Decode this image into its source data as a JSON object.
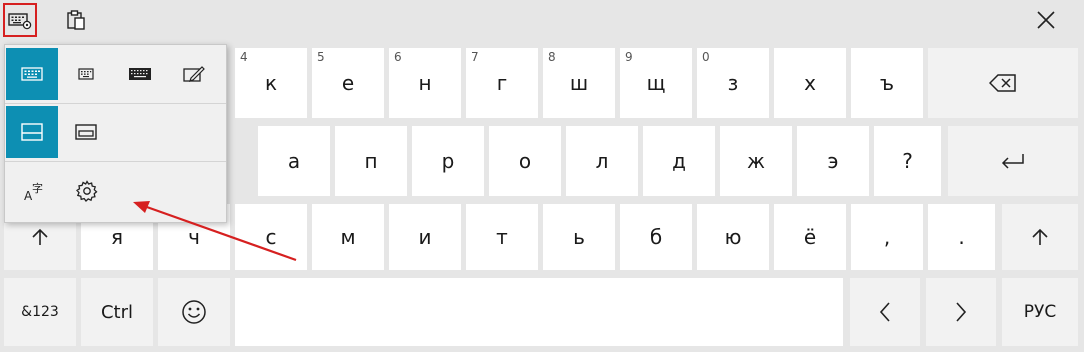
{
  "topbar": {
    "layout_button_icon": "keyboard-settings-icon",
    "clipboard_icon": "clipboard-icon",
    "close_icon": "close-icon"
  },
  "layout_menu": {
    "row1": [
      "keyboard-default-icon",
      "keyboard-small-icon",
      "keyboard-full-icon",
      "handwriting-icon"
    ],
    "row2": [
      "docked-keyboard-icon",
      "undocked-keyboard-icon"
    ],
    "row3": [
      "language-input-icon",
      "gear-icon"
    ]
  },
  "keys": {
    "row1": [
      {
        "label": "к",
        "hint": "4"
      },
      {
        "label": "е",
        "hint": "5"
      },
      {
        "label": "н",
        "hint": "6"
      },
      {
        "label": "г",
        "hint": "7"
      },
      {
        "label": "ш",
        "hint": "8"
      },
      {
        "label": "щ",
        "hint": "9"
      },
      {
        "label": "з",
        "hint": "0"
      },
      {
        "label": "х",
        "hint": ""
      },
      {
        "label": "ъ",
        "hint": ""
      }
    ],
    "row2": [
      "а",
      "п",
      "р",
      "о",
      "л",
      "д",
      "ж",
      "э",
      "?"
    ],
    "row3": [
      "я",
      "ч",
      "с",
      "м",
      "и",
      "т",
      "ь",
      "б",
      "ю",
      "ё",
      ",",
      "."
    ],
    "ctrl": "Ctrl",
    "symbols": "&123",
    "language": "РУС"
  },
  "colors": {
    "accent": "#0d8fb3",
    "highlight_border": "#d62020",
    "annotation_arrow": "#d62020"
  }
}
